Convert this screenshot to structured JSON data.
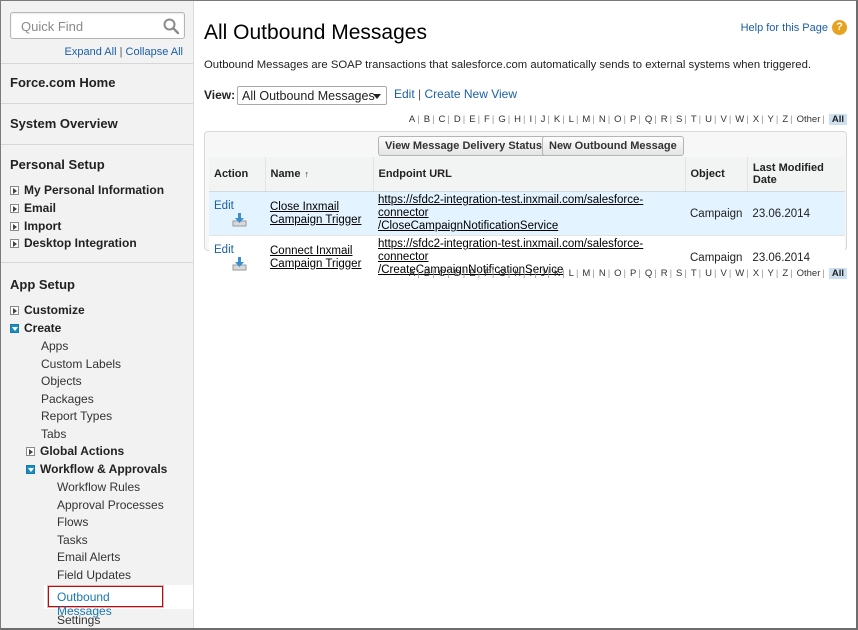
{
  "sidebar": {
    "search_placeholder": "Quick Find",
    "expand_all": "Expand All",
    "link_separator": "|",
    "collapse_all": "Collapse All",
    "force_home": "Force.com Home",
    "system_overview": "System Overview",
    "personal_setup": {
      "title": "Personal Setup",
      "items": [
        "My Personal Information",
        "Email",
        "Import",
        "Desktop Integration"
      ]
    },
    "app_setup": {
      "title": "App Setup",
      "customize": "Customize",
      "create": "Create",
      "create_items": [
        "Apps",
        "Custom Labels",
        "Objects",
        "Packages",
        "Report Types",
        "Tabs"
      ],
      "global_actions": "Global Actions",
      "workflow": "Workflow & Approvals",
      "workflow_items": [
        "Workflow Rules",
        "Approval Processes",
        "Flows",
        "Tasks",
        "Email Alerts",
        "Field Updates"
      ],
      "selected_item": "Outbound Messages",
      "settings": "Settings"
    }
  },
  "main": {
    "title": "All Outbound Messages",
    "help_text": "Help for this Page",
    "help_icon": "?",
    "description": "Outbound Messages are SOAP transactions that salesforce.com automatically sends to external systems when triggered.",
    "view_label": "View:",
    "view_selected": "All Outbound Messages",
    "edit_view": "Edit",
    "view_links_separator": "|",
    "create_new_view": "Create New View",
    "alphabet": [
      "A",
      "B",
      "C",
      "D",
      "E",
      "F",
      "G",
      "H",
      "I",
      "J",
      "K",
      "L",
      "M",
      "N",
      "O",
      "P",
      "Q",
      "R",
      "S",
      "T",
      "U",
      "V",
      "W",
      "X",
      "Y",
      "Z",
      "Other",
      "All"
    ],
    "buttons": {
      "view_status": "View Message Delivery Status",
      "new_message": "New Outbound Message"
    },
    "table": {
      "headers": {
        "action": "Action",
        "name": "Name",
        "sort_indicator": "↑",
        "endpoint": "Endpoint URL",
        "object": "Object",
        "modified": "Last Modified Date"
      },
      "rows": [
        {
          "action": "Edit",
          "name_line1": "Close Inxmail",
          "name_line2": "Campaign Trigger",
          "url_line1": "https://sfdc2-integration-test.inxmail.com/salesforce-connector",
          "url_line2": "/CloseCampaignNotificationService",
          "object": "Campaign",
          "date": "23.06.2014"
        },
        {
          "action": "Edit",
          "name_line1": "Connect Inxmail",
          "name_line2": "Campaign Trigger",
          "url_line1": "https://sfdc2-integration-test.inxmail.com/salesforce-connector",
          "url_line2": "/CreateCampaignNotificationService",
          "object": "Campaign",
          "date": "23.06.2014"
        }
      ]
    }
  },
  "colors": {
    "link": "#1a5fa6",
    "highlight_row": "#e3f3ff",
    "selected_border": "#b30d0d",
    "tree_toggle_open": "#1b8fc2"
  }
}
